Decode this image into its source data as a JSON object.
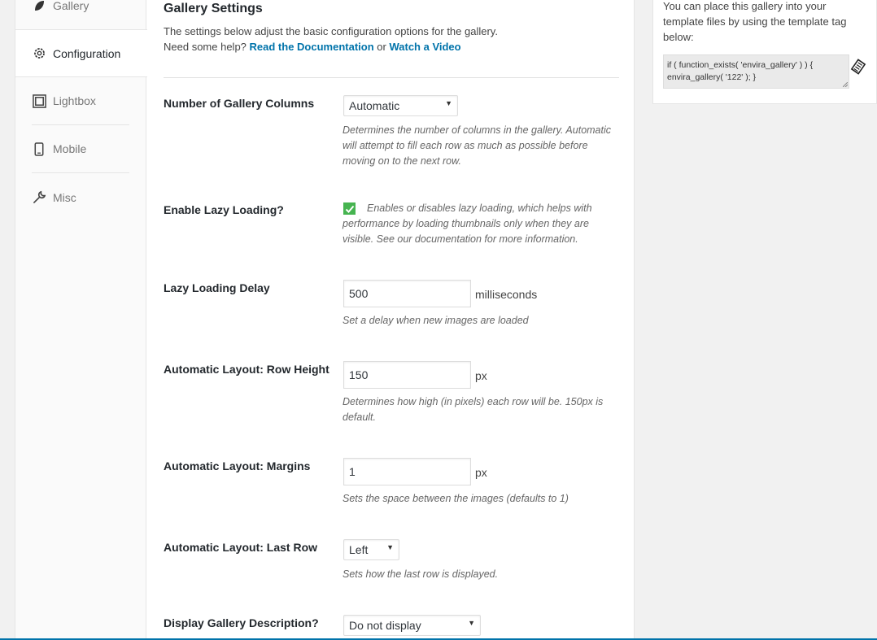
{
  "tabs": {
    "gallery": "Gallery",
    "configuration": "Configuration",
    "lightbox": "Lightbox",
    "mobile": "Mobile",
    "misc": "Misc"
  },
  "header": {
    "title": "Gallery Settings",
    "desc_line1": "The settings below adjust the basic configuration options for the gallery.",
    "help_prefix": "Need some help?",
    "doc_link": "Read the Documentation",
    "or_text": "or",
    "video_link": "Watch a Video"
  },
  "fields": {
    "columns": {
      "label": "Number of Gallery Columns",
      "value": "Automatic",
      "help": "Determines the number of columns in the gallery. Automatic will attempt to fill each row as much as possible before moving on to the next row."
    },
    "lazy": {
      "label": "Enable Lazy Loading?",
      "checked": true,
      "help": "Enables or disables lazy loading, which helps with performance by loading thumbnails only when they are visible. See our documentation for more information."
    },
    "lazy_delay": {
      "label": "Lazy Loading Delay",
      "value": "500",
      "unit": "milliseconds",
      "help": "Set a delay when new images are loaded"
    },
    "row_height": {
      "label": "Automatic Layout: Row Height",
      "value": "150",
      "unit": "px",
      "help": "Determines how high (in pixels) each row will be. 150px is default."
    },
    "margins": {
      "label": "Automatic Layout: Margins",
      "value": "1",
      "unit": "px",
      "help": "Sets the space between the images (defaults to 1)"
    },
    "last_row": {
      "label": "Automatic Layout: Last Row",
      "value": "Left",
      "help": "Sets how the last row is displayed."
    },
    "description": {
      "label": "Display Gallery Description?",
      "value": "Do not display"
    }
  },
  "sidebar": {
    "text": "You can place this gallery into your template files by using the template tag below:",
    "code_line1": "if ( function_exists( 'envira_gallery' ) ) {",
    "code_line2": "envira_gallery( '122' ); }"
  },
  "colors": {
    "link": "#0073aa",
    "check": "#46b450"
  }
}
